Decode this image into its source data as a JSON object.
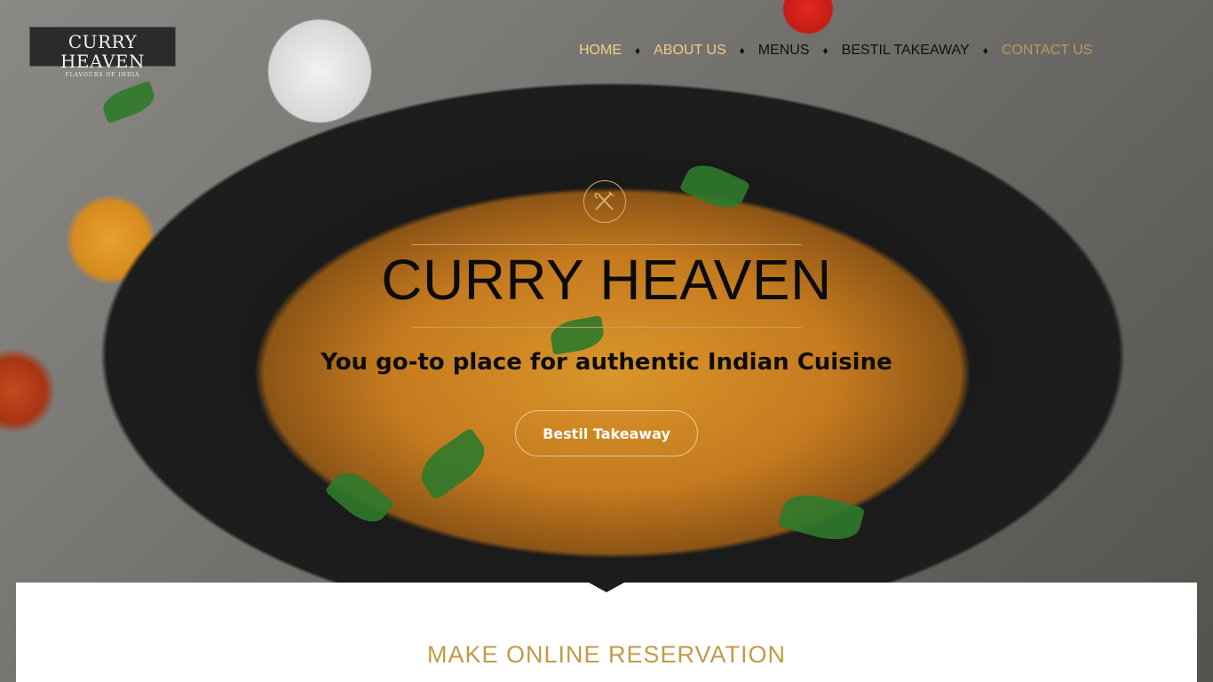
{
  "brand": {
    "logo_main": "CURRY HEAVEN",
    "logo_sub": "FLAVOURS OF INDIA"
  },
  "nav": {
    "items": [
      {
        "label": "HOME",
        "color": "#f2cf8a"
      },
      {
        "label": "ABOUT US",
        "color": "#f3c987"
      },
      {
        "label": "MENUS",
        "color": "#111111"
      },
      {
        "label": "BESTIL TAKEAWAY",
        "color": "#111111"
      },
      {
        "label": "CONTACT US",
        "color": "#b99a5e"
      }
    ],
    "separator": "♦"
  },
  "hero": {
    "emblem_icon": "fork-knife-icon",
    "title": "CURRY HEAVEN",
    "tagline": "You go-to place for authentic Indian Cuisine",
    "cta_label": "Bestil Takeaway"
  },
  "reservation": {
    "title": "MAKE ONLINE RESERVATION"
  },
  "colors": {
    "accent_gold": "#c39a48",
    "rule_gold": "#c8a062"
  }
}
